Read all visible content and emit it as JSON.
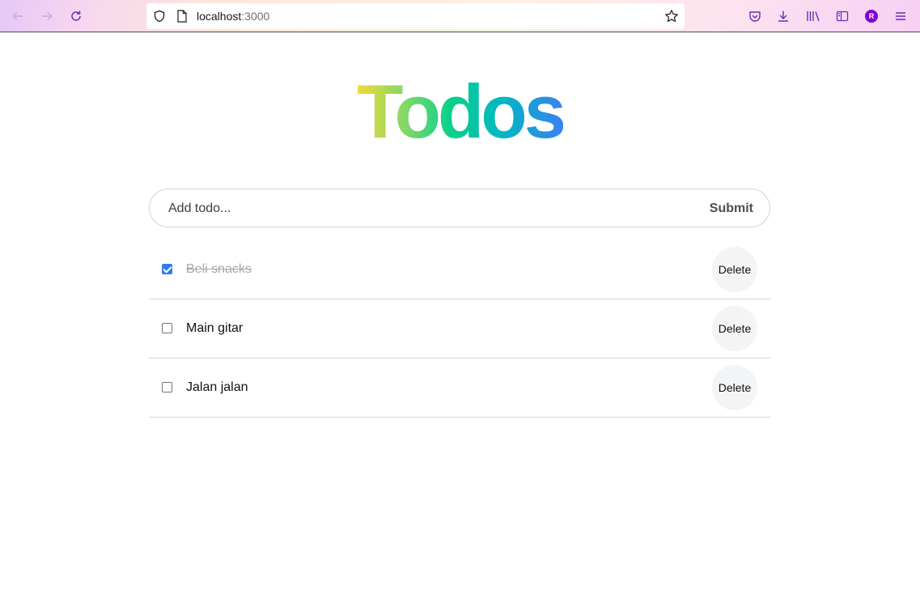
{
  "browser": {
    "url_host": "localhost",
    "url_port": ":3000",
    "avatar_letter": "R",
    "accent_color": "#8000d7"
  },
  "app": {
    "title": "Todos",
    "input_placeholder": "Add todo...",
    "submit_label": "Submit",
    "delete_label": "Delete",
    "todos": [
      {
        "text": "Beli snacks",
        "done": true
      },
      {
        "text": "Main gitar",
        "done": false
      },
      {
        "text": "Jalan jalan",
        "done": false
      }
    ]
  }
}
